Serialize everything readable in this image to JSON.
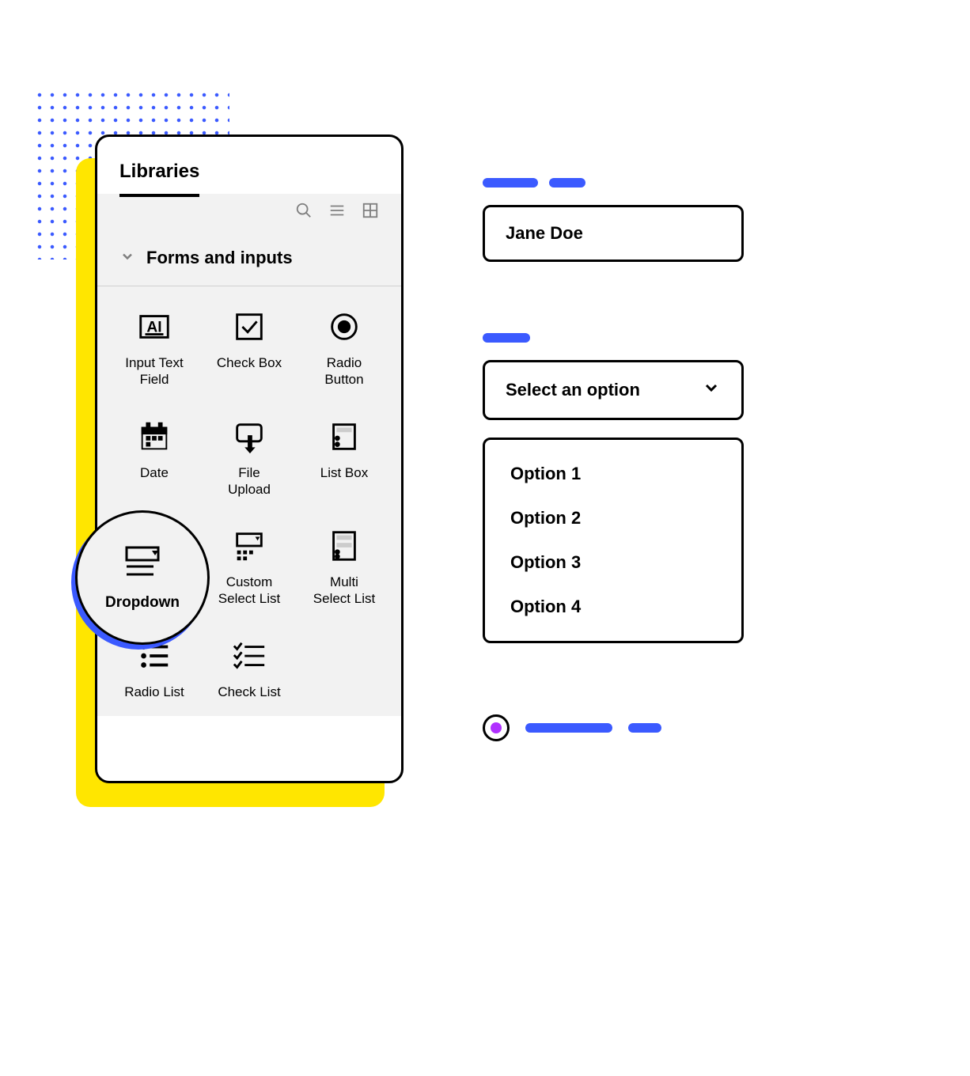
{
  "panel": {
    "title": "Libraries",
    "section_title": "Forms and inputs",
    "items": [
      {
        "label": "Input Text\nField"
      },
      {
        "label": "Check Box"
      },
      {
        "label": "Radio\nButton"
      },
      {
        "label": "Date"
      },
      {
        "label": "File\nUpload"
      },
      {
        "label": "List Box"
      },
      {
        "label": "Dropdown"
      },
      {
        "label": "Custom\nSelect List"
      },
      {
        "label": "Multi\nSelect List"
      },
      {
        "label": "Radio List"
      },
      {
        "label": "Check List"
      }
    ]
  },
  "examples": {
    "text_input_value": "Jane Doe",
    "select_placeholder": "Select an option",
    "options": [
      "Option 1",
      "Option 2",
      "Option 3",
      "Option 4"
    ]
  }
}
